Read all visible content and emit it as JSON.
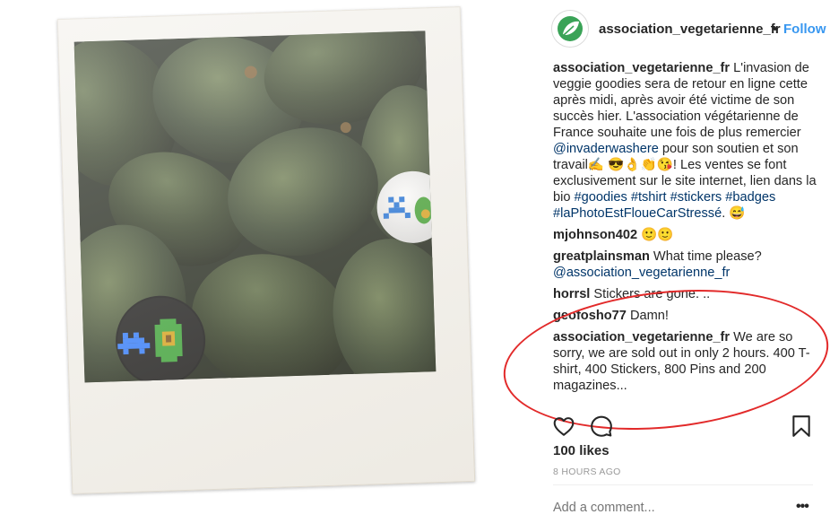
{
  "header": {
    "username": "association_vegetarienne_fr",
    "separator": "•",
    "follow_label": "Follow"
  },
  "caption": {
    "username": "association_vegetarienne_fr",
    "text_1": " L'invasion de veggie goodies sera de retour en ligne cette après midi, après avoir été victime de son succès hier. L'association végétarienne de France souhaite une fois de plus remercier ",
    "mention": "@invaderwashere",
    "text_2": " pour son soutien et son travail✍️ 😎👌👏😘! Les ventes se font exclusivement sur le site internet, lien dans la bio ",
    "hashtags": [
      "#goodies",
      "#tshirt",
      "#stickers",
      "#badges",
      "#laPhotoEstFloueCarStressé"
    ],
    "text_3": ". 😅"
  },
  "comments": [
    {
      "username": "mjohnson402",
      "text": " 🙂🙂"
    },
    {
      "username": "greatplainsman",
      "text": " What time please?",
      "mention": "@association_vegetarienne_fr"
    },
    {
      "username": "horrsl",
      "text": " Stickers are gone. .."
    },
    {
      "username": "geofosho77",
      "text": " Damn!"
    },
    {
      "username": "association_vegetarienne_fr",
      "text": " We are so sorry, we are sold out in only 2 hours. 400 T-shirt, 400 Stickers, 800 Pins and 200 magazines..."
    }
  ],
  "likes": "100 likes",
  "timestamp": "8 HOURS AGO",
  "add_comment_placeholder": "Add a comment...",
  "more_label": "•••",
  "icons": {
    "like": "heart-icon",
    "comment": "comment-icon",
    "save": "bookmark-icon",
    "avatar": "leaf-logo-icon"
  },
  "colors": {
    "link": "#003569",
    "follow": "#3897f0",
    "annotation_circle": "#e22a2a",
    "avatar_green": "#3aa357"
  }
}
